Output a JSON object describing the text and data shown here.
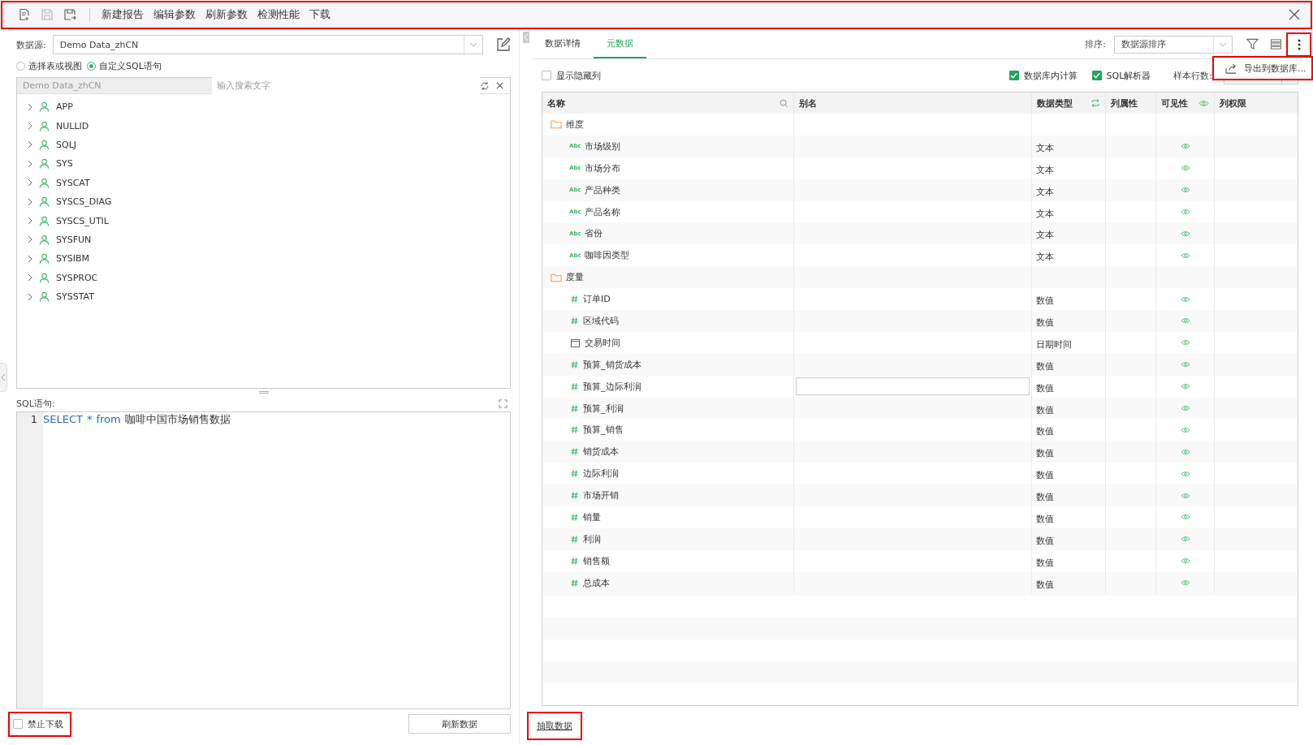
{
  "toolbar": {
    "highlighted": true,
    "menu": [
      "新建报告",
      "编辑参数",
      "刷新参数",
      "检测性能",
      "下载"
    ]
  },
  "left": {
    "datasource_label": "数据源:",
    "datasource": "Demo Data_zhCN",
    "modes": [
      {
        "label": "选择表或视图",
        "selected": false
      },
      {
        "label": "自定义SQL语句",
        "selected": true
      }
    ],
    "tree_header": "Demo Data_zhCN",
    "search_placeholder": "输入搜索文字",
    "schemas": [
      {
        "label": "APP",
        "expanded": false
      },
      {
        "label": "NULLID",
        "expanded": false
      },
      {
        "label": "SQLJ",
        "expanded": false
      },
      {
        "label": "SYS",
        "expanded": false
      },
      {
        "label": "SYSCAT",
        "expanded": false
      },
      {
        "label": "SYSCS_DIAG",
        "expanded": false
      },
      {
        "label": "SYSCS_UTIL",
        "expanded": false
      },
      {
        "label": "SYSFUN",
        "expanded": false
      },
      {
        "label": "SYSIBM",
        "expanded": false
      },
      {
        "label": "SYSPROC",
        "expanded": false
      },
      {
        "label": "SYSSTAT",
        "expanded": false
      }
    ],
    "sql_label": "SQL语句:",
    "sql_lines": [
      {
        "number": "1",
        "tokens": [
          {
            "text": "SELECT",
            "kind": "keyword"
          },
          {
            "text": "*",
            "kind": "operator"
          },
          {
            "text": "from",
            "kind": "keyword"
          },
          {
            "text": "咖啡中国市场销售数据",
            "kind": "identifier"
          }
        ]
      }
    ],
    "no_download": {
      "label": "禁止下载",
      "checked": false,
      "highlighted": true
    },
    "refresh_button": "刷新数据"
  },
  "right": {
    "tabs": [
      {
        "label": "数据详情",
        "selected": false
      },
      {
        "label": "元数据",
        "selected": true
      }
    ],
    "sort_label": "排序:",
    "sort_value": "数据源排序",
    "more_highlighted": true,
    "export_menu": {
      "label": "导出到数据库...",
      "highlighted": true
    },
    "options": [
      {
        "label": "显示隐藏列",
        "checked": false
      },
      {
        "label": "数据库内计算",
        "checked": true
      },
      {
        "label": "SQL解析器",
        "checked": true
      }
    ],
    "sample_label": "样本行数:",
    "columns": [
      "名称",
      "别名",
      "数据类型",
      "列属性",
      "可见性",
      "列权限"
    ],
    "groups": [
      {
        "label": "维度",
        "fields": [
          {
            "name": "市场级别",
            "kind": "text",
            "badge": "Abc",
            "type": "文本",
            "visible": true,
            "editing": false
          },
          {
            "name": "市场分布",
            "kind": "text",
            "badge": "Abc",
            "type": "文本",
            "visible": true,
            "editing": false
          },
          {
            "name": "产品种类",
            "kind": "text",
            "badge": "Abc",
            "type": "文本",
            "visible": true,
            "editing": false
          },
          {
            "name": "产品名称",
            "kind": "text",
            "badge": "Abc",
            "type": "文本",
            "visible": true,
            "editing": false
          },
          {
            "name": "省份",
            "kind": "text",
            "badge": "Abc",
            "type": "文本",
            "visible": true,
            "editing": false
          },
          {
            "name": "咖啡因类型",
            "kind": "text",
            "badge": "Abc",
            "type": "文本",
            "visible": true,
            "editing": false
          }
        ]
      },
      {
        "label": "度量",
        "fields": [
          {
            "name": "订单ID",
            "kind": "number",
            "type": "数值",
            "visible": true,
            "editing": false
          },
          {
            "name": "区域代码",
            "kind": "number",
            "type": "数值",
            "visible": true,
            "editing": false
          },
          {
            "name": "交易时间",
            "kind": "date",
            "type": "日期时间",
            "visible": true,
            "editing": false
          },
          {
            "name": "预算_销货成本",
            "kind": "number",
            "type": "数值",
            "visible": true,
            "editing": false
          },
          {
            "name": "预算_边际利润",
            "kind": "number",
            "type": "数值",
            "visible": true,
            "editing": true
          },
          {
            "name": "预算_利润",
            "kind": "number",
            "type": "数值",
            "visible": true,
            "editing": false
          },
          {
            "name": "预算_销售",
            "kind": "number",
            "type": "数值",
            "visible": true,
            "editing": false
          },
          {
            "name": "销货成本",
            "kind": "number",
            "type": "数值",
            "visible": true,
            "editing": false
          },
          {
            "name": "边际利润",
            "kind": "number",
            "type": "数值",
            "visible": true,
            "editing": false
          },
          {
            "name": "市场开销",
            "kind": "number",
            "type": "数值",
            "visible": true,
            "editing": false
          },
          {
            "name": "销量",
            "kind": "number",
            "type": "数值",
            "visible": true,
            "editing": false
          },
          {
            "name": "利润",
            "kind": "number",
            "type": "数值",
            "visible": true,
            "editing": false
          },
          {
            "name": "销售额",
            "kind": "number",
            "type": "数值",
            "visible": true,
            "editing": false
          },
          {
            "name": "总成本",
            "kind": "number",
            "type": "数值",
            "visible": true,
            "editing": false
          }
        ]
      }
    ],
    "extract_link": {
      "label": "抽取数据",
      "highlighted": true
    }
  }
}
